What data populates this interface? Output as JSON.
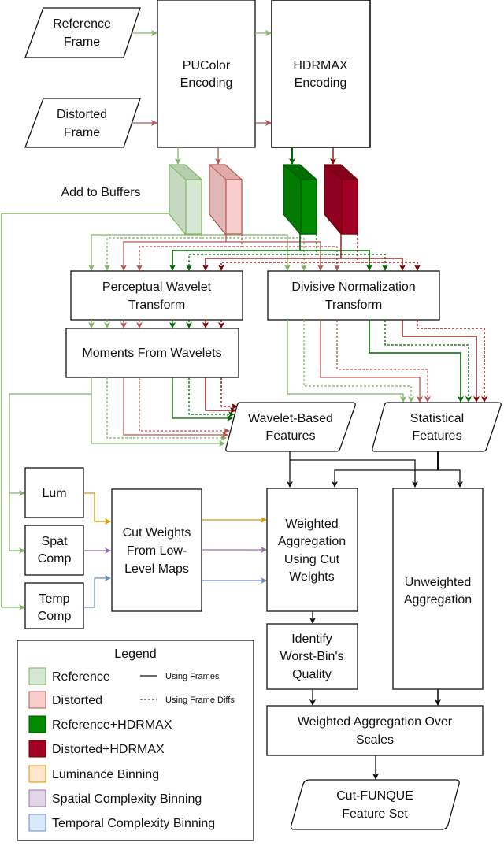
{
  "inputs": {
    "reference": [
      "Reference",
      "Frame"
    ],
    "distorted": [
      "Distorted",
      "Frame"
    ]
  },
  "encoders": {
    "pucolor": [
      "PUColor",
      "Encoding"
    ],
    "hdrmax": [
      "HDRMAX",
      "Encoding"
    ]
  },
  "buffers_label": "Add to Buffers",
  "transforms": {
    "wavelet": [
      "Perceptual Wavelet",
      "Transform"
    ],
    "divisive": [
      "Divisive Normalization",
      "Transform"
    ]
  },
  "moments": "Moments From Wavelets",
  "features": {
    "wavelet": [
      "Wavelet-Based",
      "Features"
    ],
    "statistical": [
      "Statistical",
      "Features"
    ]
  },
  "lowlevel": {
    "lum": [
      "Lum"
    ],
    "spat": [
      "Spat",
      "Comp"
    ],
    "temp": [
      "Temp",
      "Comp"
    ]
  },
  "cut_weights": [
    "Cut Weights",
    "From Low-",
    "Level Maps"
  ],
  "weighted_agg": [
    "Weighted",
    "Aggregation",
    "Using Cut",
    "Weights"
  ],
  "unweighted_agg": [
    "Unweighted",
    "Aggregation"
  ],
  "worst_bin": [
    "Identify",
    "Worst-Bin's",
    "Quality"
  ],
  "scales_agg": [
    "Weighted Aggregation Over",
    "Scales"
  ],
  "output": [
    "Cut-FUNQUE",
    "Feature Set"
  ],
  "legend": {
    "title": "Legend",
    "items": [
      {
        "label": "Reference",
        "fill": "#d5e8d4",
        "stroke": "#82b366"
      },
      {
        "label": "Distorted",
        "fill": "#f8cecc",
        "stroke": "#b85450"
      },
      {
        "label": "Reference+HDRMAX",
        "fill": "#008a00",
        "stroke": "#005700"
      },
      {
        "label": "Distorted+HDRMAX",
        "fill": "#a20025",
        "stroke": "#6f0000"
      },
      {
        "label": "Luminance Binning",
        "fill": "#ffe6cc",
        "stroke": "#d79b00"
      },
      {
        "label": "Spatial Complexity Binning",
        "fill": "#e1d5e7",
        "stroke": "#9673a6"
      },
      {
        "label": "Temporal Complexity Binning",
        "fill": "#dae8fc",
        "stroke": "#6c8ebf"
      }
    ],
    "line_styles": [
      {
        "label": "Using Frames",
        "style": "solid"
      },
      {
        "label": "Using Frame Diffs",
        "style": "dashed"
      }
    ]
  },
  "colors": {
    "ref": "#82b366",
    "dist": "#b85450",
    "ref_hdr": "#006600",
    "dist_hdr": "#800000",
    "lum": "#d79b00",
    "spat": "#9673a6",
    "temp": "#6c8ebf"
  }
}
